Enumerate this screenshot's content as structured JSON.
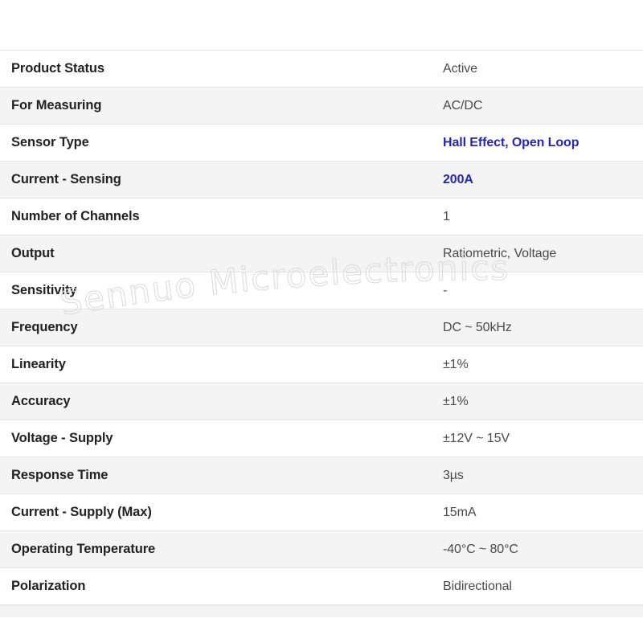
{
  "page": {
    "background_color": "#ffffff",
    "watermark": {
      "text": "Sennuo Microelectronics",
      "color": "#dcdcdc",
      "style": "outline"
    }
  },
  "spec_table": {
    "highlight_color": "#2727ad",
    "label_color": "#222222",
    "value_color": "#4a4a4a",
    "row_even_background": "#f4f4f5",
    "row_odd_background": "#ffffff",
    "rows": [
      {
        "label": "Product Status",
        "value": "Active",
        "highlight": false
      },
      {
        "label": "For Measuring",
        "value": "AC/DC",
        "highlight": false
      },
      {
        "label": "Sensor Type",
        "value": "Hall Effect, Open Loop",
        "highlight": true
      },
      {
        "label": "Current - Sensing",
        "value": "200A",
        "highlight": true
      },
      {
        "label": "Number of Channels",
        "value": "1",
        "highlight": false
      },
      {
        "label": "Output",
        "value": "Ratiometric, Voltage",
        "highlight": false
      },
      {
        "label": "Sensitivity",
        "value": "-",
        "highlight": false
      },
      {
        "label": "Frequency",
        "value": "DC ~ 50kHz",
        "highlight": false
      },
      {
        "label": "Linearity",
        "value": "±1%",
        "highlight": false
      },
      {
        "label": "Accuracy",
        "value": "±1%",
        "highlight": false
      },
      {
        "label": "Voltage - Supply",
        "value": "±12V ~ 15V",
        "highlight": false
      },
      {
        "label": "Response Time",
        "value": "3µs",
        "highlight": false
      },
      {
        "label": "Current - Supply (Max)",
        "value": "15mA",
        "highlight": false
      },
      {
        "label": "Operating Temperature",
        "value": "-40°C ~ 80°C",
        "highlight": false
      },
      {
        "label": "Polarization",
        "value": "Bidirectional",
        "highlight": false
      }
    ]
  }
}
